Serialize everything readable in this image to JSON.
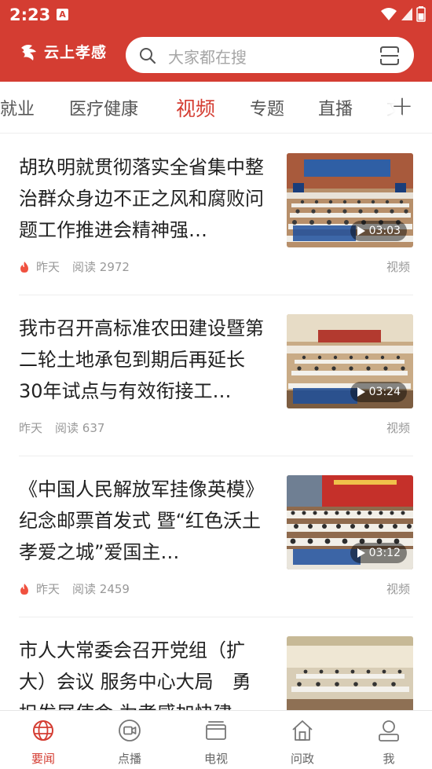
{
  "status_bar": {
    "time": "2:23",
    "notification_badge": "A"
  },
  "header": {
    "logo_text": "云上孝感",
    "search_placeholder": "大家都在搜",
    "brand_color": "#d43d32"
  },
  "tabs": [
    {
      "label": "就业",
      "active": false
    },
    {
      "label": "医疗健康",
      "active": false
    },
    {
      "label": "视频",
      "active": true
    },
    {
      "label": "专题",
      "active": false
    },
    {
      "label": "直播",
      "active": false
    },
    {
      "label": "文",
      "active": false
    }
  ],
  "feed": [
    {
      "title": "胡玖明就贯彻落实全省集中整治群众身边不正之风和腐败问题工作推进会精神强…",
      "hot": true,
      "time": "昨天",
      "views": "阅读 2972",
      "tag": "视频",
      "duration": "03:03"
    },
    {
      "title": "我市召开高标准农田建设暨第二轮土地承包到期后再延长30年试点与有效衔接工…",
      "hot": false,
      "time": "昨天",
      "views": "阅读 637",
      "tag": "视频",
      "duration": "03:24"
    },
    {
      "title": "《中国人民解放军挂像英模》纪念邮票首发式 暨“红色沃土 孝爱之城”爱国主…",
      "hot": true,
      "time": "昨天",
      "views": "阅读 2459",
      "tag": "视频",
      "duration": "03:12"
    },
    {
      "title": "市人大常委会召开党组（扩大）会议 服务中心大局　勇担发展使命 为孝感加快建…",
      "hot": false,
      "time": "",
      "views": "",
      "tag": "",
      "duration": ""
    }
  ],
  "bottom_nav": [
    {
      "label": "要闻",
      "icon": "globe-icon",
      "active": true
    },
    {
      "label": "点播",
      "icon": "video-camera-icon",
      "active": false
    },
    {
      "label": "电视",
      "icon": "tv-icon",
      "active": false
    },
    {
      "label": "问政",
      "icon": "home-icon",
      "active": false
    },
    {
      "label": "我",
      "icon": "user-icon",
      "active": false
    }
  ]
}
